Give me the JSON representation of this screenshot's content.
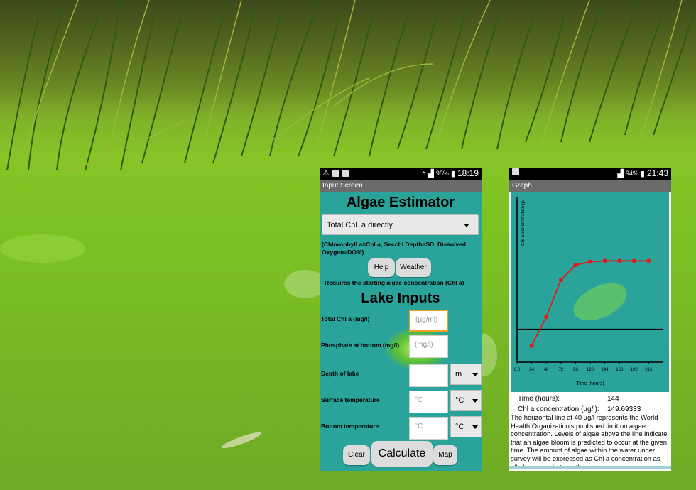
{
  "phone1": {
    "status_time": "18:19",
    "battery": "95%",
    "screen_title": "Input Screen",
    "app_title": "Algae Estimator",
    "mode_select": "Total Chl. a directly",
    "abbrev_note": "(Chlorophyll a=Chl a, Secchi Depth=SD, Dissolved Oxygen=DO%)",
    "help_label": "Help",
    "weather_label": "Weather",
    "requires_note": "Requires the starting algae concentration (Chl a)",
    "section_title": "Lake Inputs",
    "fields": [
      {
        "label": "Total Chl a (mg/l)",
        "placeholder": "(µg/ml)"
      },
      {
        "label": "Phosphate at bottom (mg/l)",
        "placeholder": "(mg/l)"
      },
      {
        "label": "Depth of lake",
        "placeholder": "",
        "unit": "m"
      },
      {
        "label": "Surface temperature",
        "placeholder": "°C",
        "unit": "°C"
      },
      {
        "label": "Bottom temperature",
        "placeholder": "°C",
        "unit": "°C"
      }
    ],
    "clear_label": "Clear",
    "calculate_label": "Calculate",
    "map_label": "Map"
  },
  "phone2": {
    "status_time": "21:43",
    "battery": "94%",
    "screen_title": "Graph",
    "chart_data": {
      "type": "line",
      "ylabel": "Chl a concentration (µ",
      "xlabel": "Time (hours)",
      "x": [
        24,
        48,
        72,
        96,
        120,
        144,
        168,
        192,
        216
      ],
      "x_tick_labels": [
        "0.0",
        "24",
        "48",
        "72",
        "96",
        "120",
        "144",
        "168",
        "192",
        "216"
      ],
      "values": [
        20,
        55,
        100,
        118,
        122,
        123,
        123,
        123,
        123
      ],
      "threshold_line": 40,
      "xlim": [
        0,
        240
      ],
      "ylim": [
        0,
        200
      ],
      "colors": {
        "line": "#e01b1b",
        "background": "#2aa39b"
      }
    },
    "time_label": "Time (hours):",
    "time_value": "144",
    "chl_label": "Chl a concentration (µg/l):",
    "chl_value": "149.69333",
    "description": "The horizontal line at 40 µg/l represents the World Health Organization's published limit on algae concentration.  Levels of algae above the line indicate that an algae bloom is predicted to occur at the given time.   The amount of algae within the water under survey will be expressed as Chl a concentration as all algae are photosynthesising"
  }
}
